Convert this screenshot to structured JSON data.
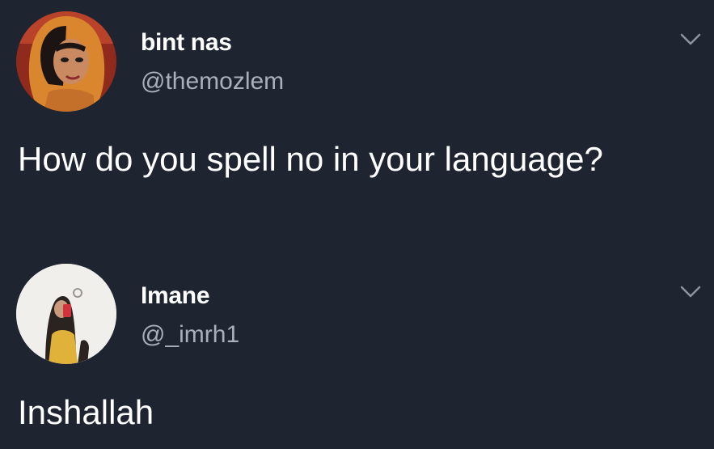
{
  "colors": {
    "background": "#1e2531",
    "text_primary": "#ffffff",
    "text_secondary": "#a8b0bb",
    "chevron": "#8b939e"
  },
  "tweets": [
    {
      "display_name": "bint nas",
      "handle": "@themozlem",
      "text": "How do you spell no in your language?",
      "avatar_icon": "cartoon-princess-avatar",
      "menu_icon": "chevron-down-icon"
    },
    {
      "display_name": "Imane",
      "handle": "@_imrh1",
      "text": "Inshallah",
      "avatar_icon": "mirror-selfie-avatar",
      "menu_icon": "chevron-down-icon"
    }
  ]
}
